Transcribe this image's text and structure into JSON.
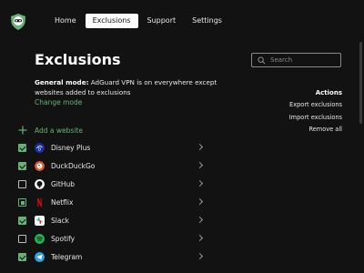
{
  "nav": {
    "items": [
      "Home",
      "Exclusions",
      "Support",
      "Settings"
    ],
    "active": "Exclusions"
  },
  "page": {
    "title": "Exclusions",
    "mode_label": "General mode:",
    "mode_description": " AdGuard VPN is on everywhere except websites added to exclusions",
    "change_mode": "Change mode"
  },
  "search": {
    "placeholder": "Search",
    "value": ""
  },
  "actions": {
    "heading": "Actions",
    "items": [
      "Export exclusions",
      "Import exclusions",
      "Remove all"
    ]
  },
  "add_website": "Add a website",
  "exclusions": [
    {
      "name": "Disney Plus",
      "state": "checked",
      "icon": "disney-plus-icon",
      "color": "#1a2fa0"
    },
    {
      "name": "DuckDuckGo",
      "state": "checked",
      "icon": "duckduckgo-icon",
      "color": "#de5833"
    },
    {
      "name": "GitHub",
      "state": "unchecked",
      "icon": "github-icon",
      "color": "#ffffff"
    },
    {
      "name": "Netflix",
      "state": "partial",
      "icon": "netflix-icon",
      "color": "#e50914"
    },
    {
      "name": "Slack",
      "state": "checked",
      "icon": "slack-icon",
      "color": "#ffffff"
    },
    {
      "name": "Spotify",
      "state": "unchecked",
      "icon": "spotify-icon",
      "color": "#1db954"
    },
    {
      "name": "Telegram",
      "state": "checked",
      "icon": "telegram-icon",
      "color": "#2aa3df"
    }
  ],
  "colors": {
    "background": "#121212",
    "accent_green": "#67b279",
    "text": "#e8e8e8"
  }
}
